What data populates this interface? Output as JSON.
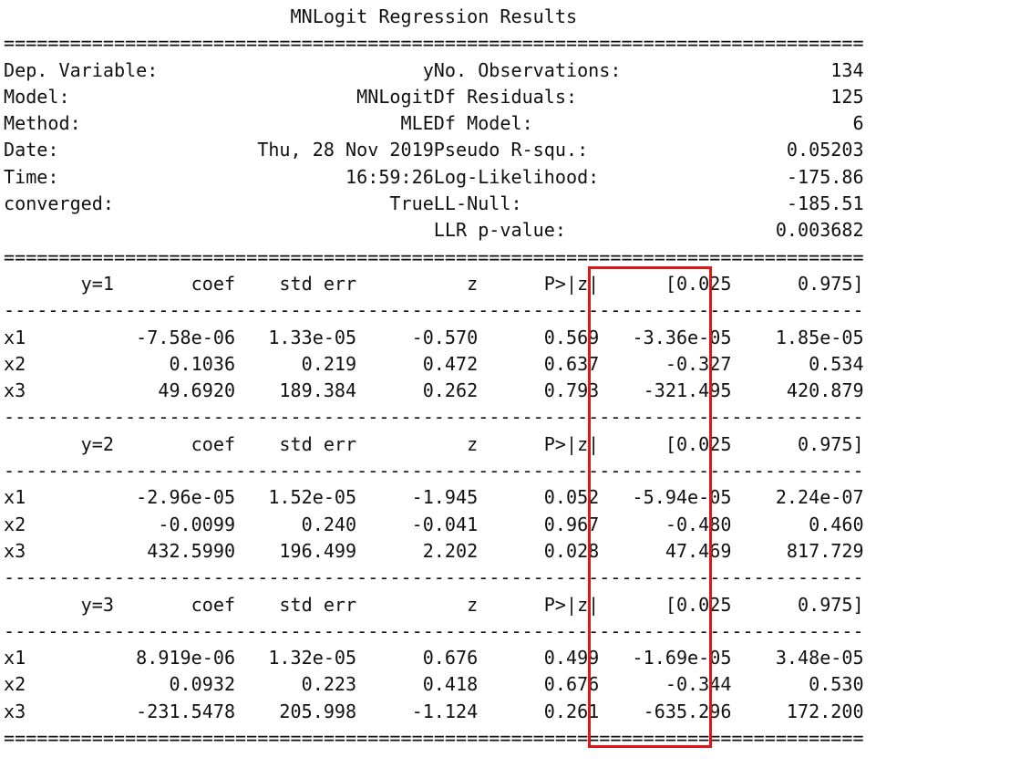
{
  "title": "MNLogit Regression Results",
  "rule_double": "==============================================================================",
  "rule_single": "------------------------------------------------------------------------------",
  "summary": [
    {
      "left_label": "Dep. Variable:",
      "left_value": "y",
      "right_label": "No. Observations:",
      "right_value": "134"
    },
    {
      "left_label": "Model:",
      "left_value": "MNLogit",
      "right_label": "Df Residuals:",
      "right_value": "125"
    },
    {
      "left_label": "Method:",
      "left_value": "MLE",
      "right_label": "Df Model:",
      "right_value": "6"
    },
    {
      "left_label": "Date:",
      "left_value": "Thu, 28 Nov 2019",
      "right_label": "Pseudo R-squ.:",
      "right_value": "0.05203"
    },
    {
      "left_label": "Time:",
      "left_value": "16:59:26",
      "right_label": "Log-Likelihood:",
      "right_value": "-175.86"
    },
    {
      "left_label": "converged:",
      "left_value": "True",
      "right_label": "LL-Null:",
      "right_value": "-185.51"
    },
    {
      "left_label": "",
      "left_value": "",
      "right_label": "LLR p-value:",
      "right_value": "0.003682"
    }
  ],
  "columns": [
    "coef",
    "std err",
    "z",
    "P>|z|",
    "[0.025",
    "0.975]"
  ],
  "blocks": [
    {
      "label": "y=1",
      "rows": [
        [
          "x1",
          "-7.58e-06",
          "1.33e-05",
          "-0.570",
          "0.569",
          "-3.36e-05",
          "1.85e-05"
        ],
        [
          "x2",
          "0.1036",
          "0.219",
          "0.472",
          "0.637",
          "-0.327",
          "0.534"
        ],
        [
          "x3",
          "49.6920",
          "189.384",
          "0.262",
          "0.793",
          "-321.495",
          "420.879"
        ]
      ]
    },
    {
      "label": "y=2",
      "rows": [
        [
          "x1",
          "-2.96e-05",
          "1.52e-05",
          "-1.945",
          "0.052",
          "-5.94e-05",
          "2.24e-07"
        ],
        [
          "x2",
          "-0.0099",
          "0.240",
          "-0.041",
          "0.967",
          "-0.480",
          "0.460"
        ],
        [
          "x3",
          "432.5990",
          "196.499",
          "2.202",
          "0.028",
          "47.469",
          "817.729"
        ]
      ]
    },
    {
      "label": "y=3",
      "rows": [
        [
          "x1",
          "8.919e-06",
          "1.32e-05",
          "0.676",
          "0.499",
          "-1.69e-05",
          "3.48e-05"
        ],
        [
          "x2",
          "0.0932",
          "0.223",
          "0.418",
          "0.676",
          "-0.344",
          "0.530"
        ],
        [
          "x3",
          "-231.5478",
          "205.998",
          "-1.124",
          "0.261",
          "-635.296",
          "172.200"
        ]
      ]
    }
  ],
  "highlight_color": "#e01616"
}
